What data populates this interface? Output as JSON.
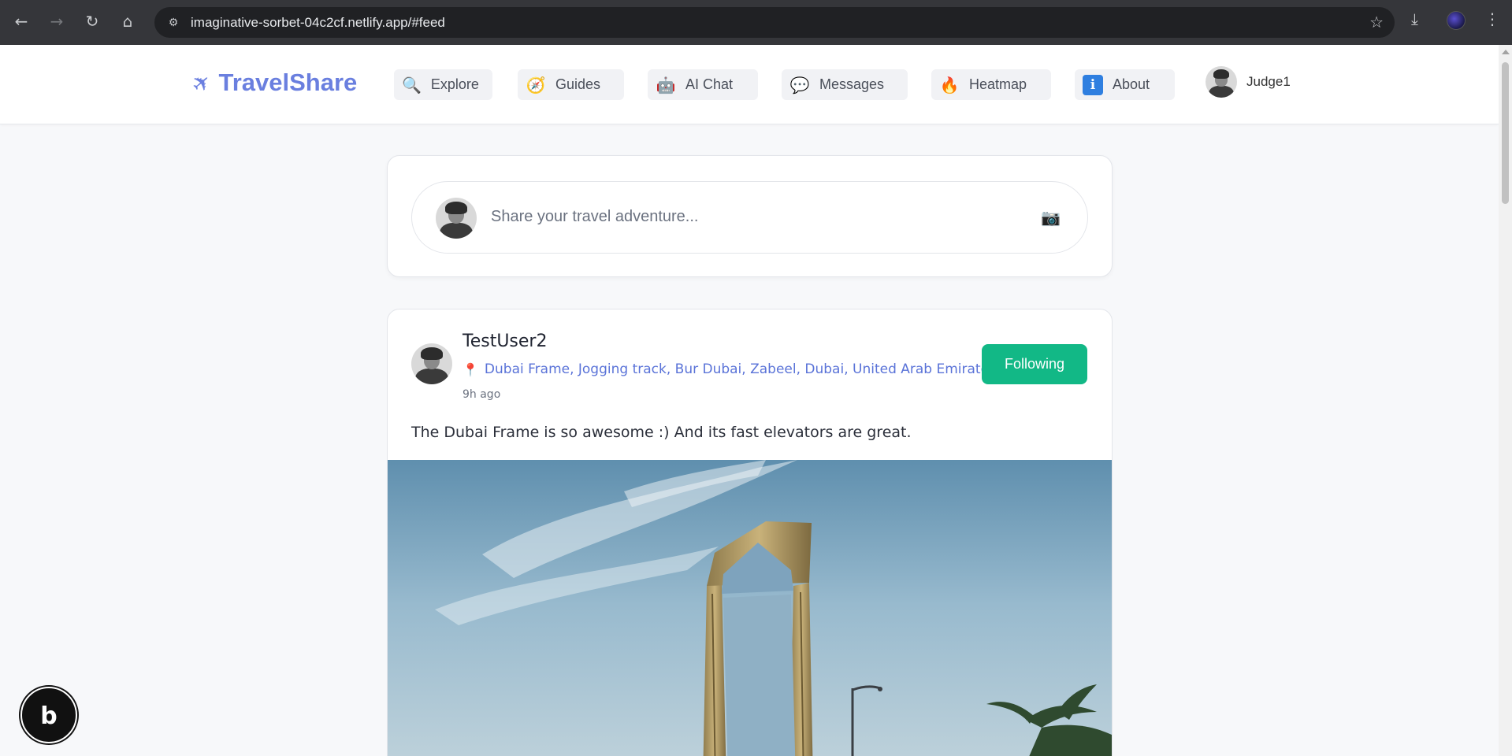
{
  "browser": {
    "url": "imaginative-sorbet-04c2cf.netlify.app/#feed",
    "back_icon": "←",
    "forward_icon": "→",
    "reload_icon": "↻",
    "home_icon": "⌂",
    "site_info_icon": "⚙",
    "star_icon": "☆",
    "download_icon": "⤓",
    "menu_icon": "⋮"
  },
  "header": {
    "brand_icon": "✈",
    "brand_name": "TravelShare",
    "nav": [
      {
        "label": "Explore",
        "icon": "🔍"
      },
      {
        "label": "Guides",
        "icon": "🧭"
      },
      {
        "label": "AI Chat",
        "icon": "🤖"
      },
      {
        "label": "Messages",
        "icon": "💬"
      },
      {
        "label": "Heatmap",
        "icon": "🔥"
      },
      {
        "label": "About",
        "icon": "ℹ"
      }
    ],
    "user": {
      "name": "Judge1"
    }
  },
  "composer": {
    "placeholder": "Share your travel adventure...",
    "camera_icon": "📷"
  },
  "post": {
    "author": "TestUser2",
    "pin_icon": "📍",
    "location": "Dubai Frame, Jogging track, Bur Dubai, Zabeel, Dubai, United Arab Emirates",
    "time": "9h ago",
    "follow_label": "Following",
    "follow_color": "#12b886",
    "caption": "The Dubai Frame is so awesome :) And its fast elevators are great."
  },
  "badge": {
    "letter": "b"
  },
  "colors": {
    "brand": "#6a7fdf",
    "accent_link": "#5a73d8"
  }
}
